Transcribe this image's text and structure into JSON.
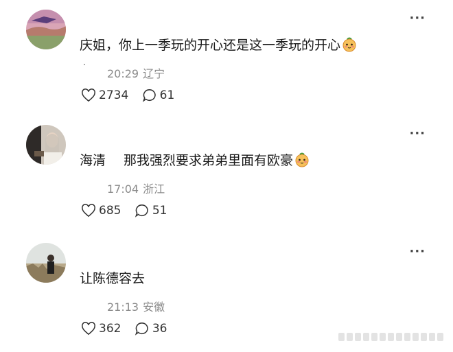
{
  "comments": [
    {
      "text": "庆姐，你上一季玩的开心还是这一季玩的开心",
      "time": "20:29",
      "location": "辽宁",
      "likes": "2734",
      "replies": "61"
    },
    {
      "name": "海清",
      "text": "那我强烈要求弟弟里面有欧豪",
      "time": "17:04",
      "location": "浙江",
      "likes": "685",
      "replies": "51"
    },
    {
      "text": "让陈德容去",
      "time": "21:13",
      "location": "安徽",
      "likes": "362",
      "replies": "36"
    }
  ],
  "icons": {
    "more": "more-dots-icon",
    "like": "heart-icon",
    "reply": "comment-bubble-icon",
    "emoji": "peach-face-emoji"
  }
}
